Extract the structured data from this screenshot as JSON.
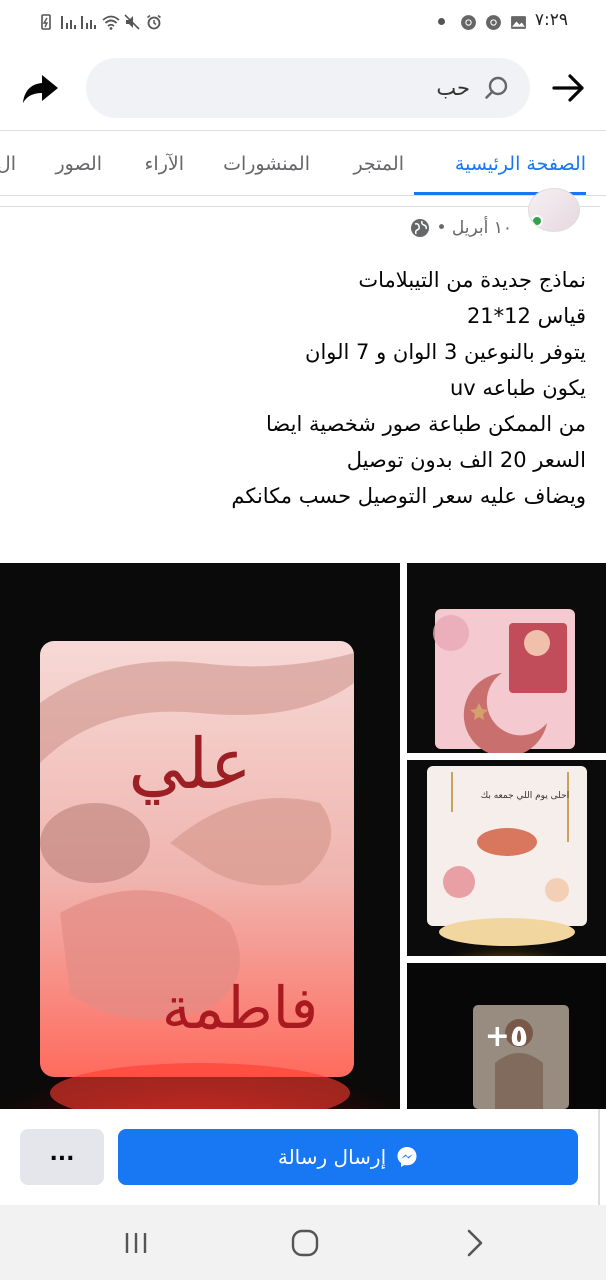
{
  "status_bar": {
    "time": "٧:٢٩"
  },
  "search": {
    "value": "حب",
    "placeholder": "حب"
  },
  "tabs": [
    {
      "label": "الصفحة الرئيسية",
      "active": true
    },
    {
      "label": "المتجر",
      "active": false
    },
    {
      "label": "المنشورات",
      "active": false
    },
    {
      "label": "الآراء",
      "active": false
    },
    {
      "label": "الصور",
      "active": false
    },
    {
      "label": "ال",
      "active": false
    }
  ],
  "post": {
    "date": "١٠ أبريل •",
    "lines": [
      "نماذج جديدة من التيبلامات",
      "قياس  12*21",
      "يتوفر بالنوعين 3 الوان و 7 الوان",
      "يكون طباعه uv",
      "من الممكن طباعة صور شخصية ايضا",
      "السعر 20 الف بدون توصيل",
      "ويضاف عليه سعر التوصيل حسب مكانكم"
    ],
    "more_photos": "+٥",
    "photo_main_text_top": "علي",
    "photo_main_text_bottom": "فاطمة",
    "photo_s2_text": "احلى يوم اللي جمعه بك"
  },
  "actions": {
    "send_message": "إرسال رسالة",
    "more": "..."
  },
  "colors": {
    "accent": "#1877f2",
    "tab_inactive": "#65676b",
    "online": "#31a24c"
  },
  "icons": {
    "search": "search-icon",
    "back": "arrow-icon",
    "share": "share-icon",
    "globe": "globe-icon",
    "messenger": "messenger-icon"
  }
}
